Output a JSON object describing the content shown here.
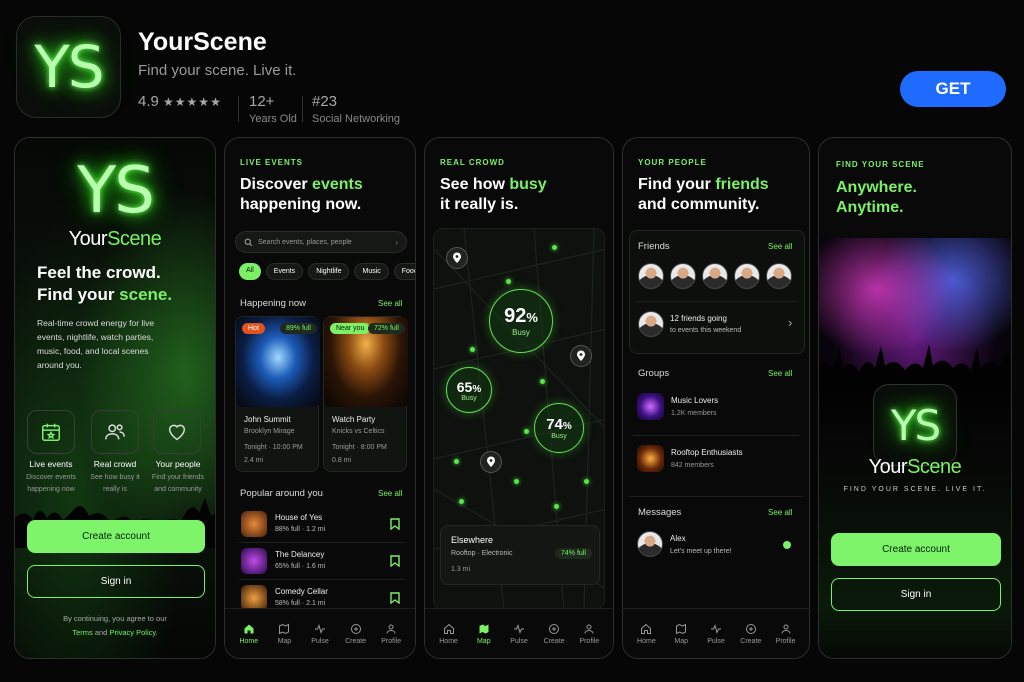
{
  "app": {
    "icon_text": "YS",
    "name": "YourScene",
    "tagline": "Find your scene. Live it.",
    "rating": "4.9",
    "stars": "★★★★★",
    "age": "12+",
    "age_label": "Years Old",
    "rank": "#23",
    "category": "Social Networking",
    "get_label": "GET"
  },
  "p1": {
    "logo": "YS",
    "brand_a": "Your",
    "brand_b": "Scene",
    "head_a": "Feel the crowd.",
    "head_b": "Find your ",
    "head_c": "scene.",
    "body": "Real-time crowd energy for live events, nightlife, watch parties, music, food, and local scenes around you.",
    "features": [
      {
        "title": "Live events",
        "desc": "Discover events happening now",
        "icon": "calendar-star-icon"
      },
      {
        "title": "Real crowd",
        "desc": "See how busy it really is",
        "icon": "people-icon"
      },
      {
        "title": "Your people",
        "desc": "Find your friends and community",
        "icon": "heart-icon"
      }
    ],
    "create": "Create account",
    "signin": "Sign in",
    "terms_a": "By continuing, you agree to our",
    "terms_b": "Terms",
    "terms_c": "and",
    "terms_d": "Privacy Policy."
  },
  "p2": {
    "label": "LIVE EVENTS",
    "head_a": "Discover ",
    "head_b": "events",
    "head_c": "happening now.",
    "search_placeholder": "Search events, places, people",
    "chips": [
      "All",
      "Events",
      "Nightlife",
      "Music",
      "Food"
    ],
    "happening": "Happening now",
    "see_all": "See all",
    "events": [
      {
        "tag": "Hot",
        "full": "89% full",
        "name": "John Summit",
        "venue": "Brooklyn Mirage",
        "time": "Tonight · 10:00 PM",
        "dist": "2.4 mi"
      },
      {
        "tag": "Near you",
        "full": "72% full",
        "name": "Watch Party",
        "venue": "Knicks vs Celtics",
        "time": "Tonight · 8:00 PM",
        "dist": "0.8 mi"
      }
    ],
    "popular": "Popular around you",
    "places": [
      {
        "name": "House of Yes",
        "meta": "88% full · 1.2 mi"
      },
      {
        "name": "The Delancey",
        "meta": "65% full · 1.6 mi"
      },
      {
        "name": "Comedy Cellar",
        "meta": "58% full · 2.1 mi"
      }
    ]
  },
  "nav": [
    "Home",
    "Map",
    "Pulse",
    "Create",
    "Profile"
  ],
  "p3": {
    "label": "REAL CROWD",
    "head_a": "See how ",
    "head_b": "busy",
    "head_c": "it really is.",
    "bubbles": [
      {
        "pct": "92",
        "unit": "%",
        "busy": "Busy"
      },
      {
        "pct": "65",
        "unit": "%",
        "busy": "Busy"
      },
      {
        "pct": "74",
        "unit": "%",
        "busy": "Busy"
      }
    ],
    "card_title": "Elsewhere",
    "card_sub": "Rooftop · Electronic",
    "card_full": "74% full",
    "card_dist": "1.3 mi"
  },
  "p4": {
    "label": "YOUR PEOPLE",
    "head_a": "Find your ",
    "head_b": "friends",
    "head_c": "and community.",
    "friends": "Friends",
    "see_all": "See all",
    "going_a": "12 friends going",
    "going_b": "to events this weekend",
    "groups": "Groups",
    "group_list": [
      {
        "name": "Music Lovers",
        "members": "1.2K members"
      },
      {
        "name": "Rooftop Enthusiasts",
        "members": "842 members"
      }
    ],
    "messages": "Messages",
    "msg_name": "Alex",
    "msg_text": "Let's meet up there!"
  },
  "p5": {
    "label": "FIND YOUR SCENE",
    "head_a": "Anywhere.",
    "head_b": "Anytime.",
    "logo": "YS",
    "brand_a": "Your",
    "brand_b": "Scene",
    "tag": "FIND YOUR SCENE. LIVE IT.",
    "create": "Create account",
    "signin": "Sign in"
  },
  "colors": {
    "accent": "#7cf066",
    "get": "#1f6bff"
  }
}
